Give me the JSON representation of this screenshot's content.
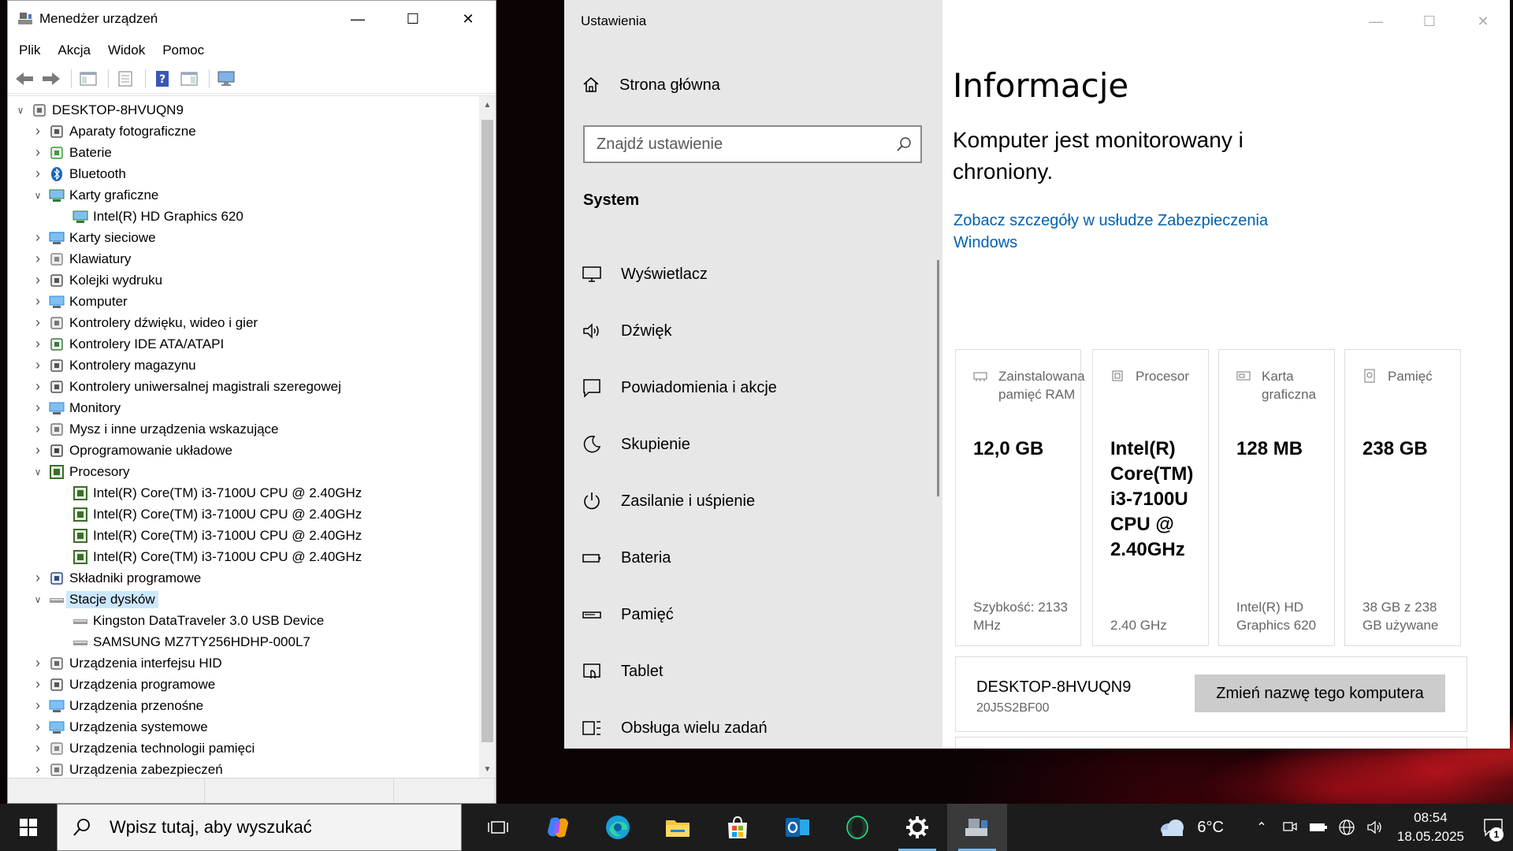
{
  "device_manager": {
    "title": "Menedżer urządzeń",
    "menu": [
      "Plik",
      "Akcja",
      "Widok",
      "Pomoc"
    ],
    "tree": [
      {
        "label": "DESKTOP-8HVUQN9",
        "level": 0,
        "state": "expanded",
        "icon": "computer-root-icon"
      },
      {
        "label": "Aparaty fotograficzne",
        "level": 1,
        "state": "collapsed",
        "icon": "camera-icon"
      },
      {
        "label": "Baterie",
        "level": 1,
        "state": "collapsed",
        "icon": "battery-icon"
      },
      {
        "label": "Bluetooth",
        "level": 1,
        "state": "collapsed",
        "icon": "bluetooth-icon"
      },
      {
        "label": "Karty graficzne",
        "level": 1,
        "state": "expanded",
        "icon": "display-adapter-icon"
      },
      {
        "label": "Intel(R) HD Graphics 620",
        "level": 2,
        "state": "leaf",
        "icon": "display-adapter-icon"
      },
      {
        "label": "Karty sieciowe",
        "level": 1,
        "state": "collapsed",
        "icon": "network-adapter-icon"
      },
      {
        "label": "Klawiatury",
        "level": 1,
        "state": "collapsed",
        "icon": "keyboard-icon"
      },
      {
        "label": "Kolejki wydruku",
        "level": 1,
        "state": "collapsed",
        "icon": "printer-icon"
      },
      {
        "label": "Komputer",
        "level": 1,
        "state": "collapsed",
        "icon": "monitor-icon"
      },
      {
        "label": "Kontrolery dźwięku, wideo i gier",
        "level": 1,
        "state": "collapsed",
        "icon": "speaker-icon"
      },
      {
        "label": "Kontrolery IDE ATA/ATAPI",
        "level": 1,
        "state": "collapsed",
        "icon": "ide-controller-icon"
      },
      {
        "label": "Kontrolery magazynu",
        "level": 1,
        "state": "collapsed",
        "icon": "storage-controller-icon"
      },
      {
        "label": "Kontrolery uniwersalnej magistrali szeregowej",
        "level": 1,
        "state": "collapsed",
        "icon": "usb-icon"
      },
      {
        "label": "Monitory",
        "level": 1,
        "state": "collapsed",
        "icon": "monitor-icon"
      },
      {
        "label": "Mysz i inne urządzenia wskazujące",
        "level": 1,
        "state": "collapsed",
        "icon": "mouse-icon"
      },
      {
        "label": "Oprogramowanie układowe",
        "level": 1,
        "state": "collapsed",
        "icon": "firmware-icon"
      },
      {
        "label": "Procesory",
        "level": 1,
        "state": "expanded",
        "icon": "cpu-icon"
      },
      {
        "label": "Intel(R) Core(TM) i3-7100U CPU @ 2.40GHz",
        "level": 2,
        "state": "leaf",
        "icon": "cpu-icon"
      },
      {
        "label": "Intel(R) Core(TM) i3-7100U CPU @ 2.40GHz",
        "level": 2,
        "state": "leaf",
        "icon": "cpu-icon"
      },
      {
        "label": "Intel(R) Core(TM) i3-7100U CPU @ 2.40GHz",
        "level": 2,
        "state": "leaf",
        "icon": "cpu-icon"
      },
      {
        "label": "Intel(R) Core(TM) i3-7100U CPU @ 2.40GHz",
        "level": 2,
        "state": "leaf",
        "icon": "cpu-icon"
      },
      {
        "label": "Składniki programowe",
        "level": 1,
        "state": "collapsed",
        "icon": "software-component-icon"
      },
      {
        "label": "Stacje dysków",
        "level": 1,
        "state": "expanded",
        "icon": "disk-drive-icon",
        "selected": true
      },
      {
        "label": "Kingston DataTraveler 3.0 USB Device",
        "level": 2,
        "state": "leaf",
        "icon": "disk-drive-icon"
      },
      {
        "label": "SAMSUNG MZ7TY256HDHP-000L7",
        "level": 2,
        "state": "leaf",
        "icon": "disk-drive-icon"
      },
      {
        "label": "Urządzenia interfejsu HID",
        "level": 1,
        "state": "collapsed",
        "icon": "hid-icon"
      },
      {
        "label": "Urządzenia programowe",
        "level": 1,
        "state": "collapsed",
        "icon": "software-device-icon"
      },
      {
        "label": "Urządzenia przenośne",
        "level": 1,
        "state": "collapsed",
        "icon": "portable-device-icon"
      },
      {
        "label": "Urządzenia systemowe",
        "level": 1,
        "state": "collapsed",
        "icon": "system-device-icon"
      },
      {
        "label": "Urządzenia technologii pamięci",
        "level": 1,
        "state": "collapsed",
        "icon": "memory-tech-icon"
      },
      {
        "label": "Urządzenia zabezpieczeń",
        "level": 1,
        "state": "collapsed",
        "icon": "security-device-icon"
      }
    ]
  },
  "settings": {
    "app_title": "Ustawienia",
    "home_label": "Strona główna",
    "search_placeholder": "Znajdź ustawienie",
    "section": "System",
    "nav": [
      {
        "label": "Wyświetlacz",
        "icon": "display-icon"
      },
      {
        "label": "Dźwięk",
        "icon": "sound-icon"
      },
      {
        "label": "Powiadomienia i akcje",
        "icon": "notifications-icon"
      },
      {
        "label": "Skupienie",
        "icon": "focus-moon-icon"
      },
      {
        "label": "Zasilanie i uśpienie",
        "icon": "power-icon"
      },
      {
        "label": "Bateria",
        "icon": "battery-icon"
      },
      {
        "label": "Pamięć",
        "icon": "storage-icon"
      },
      {
        "label": "Tablet",
        "icon": "tablet-icon"
      },
      {
        "label": "Obsługa wielu zadań",
        "icon": "multitasking-icon"
      }
    ],
    "heading": "Informacje",
    "protection_text": "Komputer jest monitorowany i chroniony.",
    "security_link": "Zobacz szczegóły w usłudze Zabezpieczenia Windows",
    "specs": [
      {
        "label": "Zainstalowana pamięć RAM",
        "value": "12,0 GB",
        "footer": "Szybkość: 2133 MHz",
        "icon": "ram-icon"
      },
      {
        "label": "Procesor",
        "value": "Intel(R) Core(TM) i3-7100U CPU @ 2.40GHz",
        "footer": "2.40 GHz",
        "icon": "processor-icon"
      },
      {
        "label": "Karta graficzna",
        "value": "128 MB",
        "footer": "Intel(R) HD Graphics 620",
        "icon": "gpu-icon"
      },
      {
        "label": "Pamięć",
        "value": "238 GB",
        "footer": "38 GB z 238 GB używane",
        "icon": "disk-icon"
      }
    ],
    "device_name": "DESKTOP-8HVUQN9",
    "device_code": "20J5S2BF00",
    "rename_button": "Zmień nazwę tego komputera"
  },
  "taskbar": {
    "search_placeholder": "Wpisz tutaj, aby wyszukać",
    "apps": [
      {
        "name": "task-view-icon",
        "active": false,
        "running": false
      },
      {
        "name": "copilot-icon",
        "active": false,
        "running": false
      },
      {
        "name": "edge-icon",
        "active": false,
        "running": false
      },
      {
        "name": "file-explorer-icon",
        "active": false,
        "running": false
      },
      {
        "name": "microsoft-store-icon",
        "active": false,
        "running": false
      },
      {
        "name": "outlook-icon",
        "active": false,
        "running": false
      },
      {
        "name": "opera-gx-icon",
        "active": false,
        "running": false
      },
      {
        "name": "settings-gear-icon",
        "active": false,
        "running": true
      },
      {
        "name": "device-manager-icon",
        "active": true,
        "running": true
      }
    ],
    "weather_temp": "6°C",
    "time": "08:54",
    "date": "18.05.2025",
    "notification_count": "1"
  }
}
